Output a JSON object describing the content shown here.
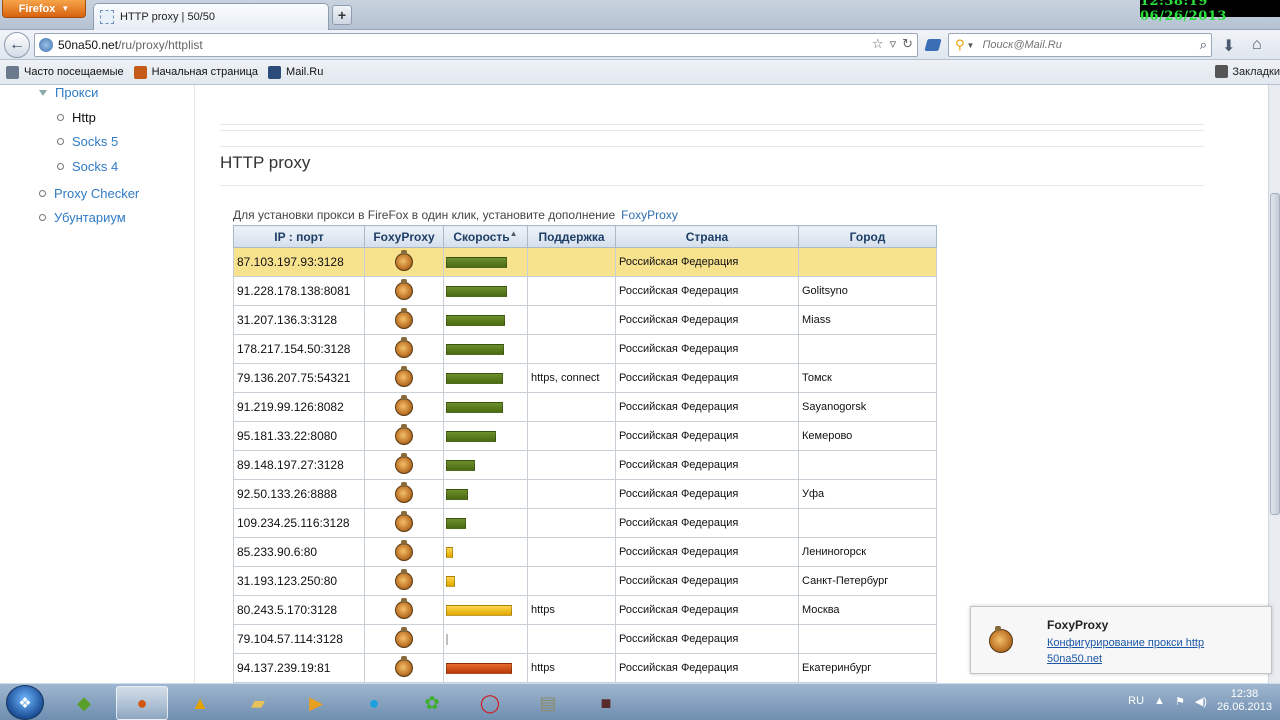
{
  "browser": {
    "app_button": "Firefox",
    "tab_title": "HTTP proxy | 50/50",
    "new_tab": "+",
    "clock": "12:38:19  06/26/2013",
    "url_host": "50na50.net",
    "url_path": "/ru/proxy/httplist",
    "search_placeholder": "Поиск@Mail.Ru"
  },
  "bookmarks": [
    {
      "label": "Часто посещаемые",
      "color": "#6a7a8c"
    },
    {
      "label": "Начальная страница",
      "color": "#c45b18"
    },
    {
      "label": "Mail.Ru",
      "color": "#2b4c7a"
    }
  ],
  "bookmarks_right": "Закладки",
  "sidebar": {
    "section": "Прокси",
    "items": [
      "Http",
      "Socks 5",
      "Socks 4"
    ],
    "links": [
      "Proxy Checker",
      "Убунтариум"
    ]
  },
  "page": {
    "title": "HTTP proxy",
    "info_text": "Для установки прокси в FireFox в один клик, установите дополнение",
    "info_link": "FoxyProxy"
  },
  "table": {
    "headers": [
      "IP : порт",
      "FoxyProxy",
      "Скорость",
      "Поддержка",
      "Страна",
      "Город"
    ],
    "rows": [
      {
        "ip": "87.103.197.93:3128",
        "speed": 0.92,
        "bar": "green",
        "support": "",
        "country": "Российская Федерация",
        "city": "",
        "highlight": true
      },
      {
        "ip": "91.228.178.138:8081",
        "speed": 0.92,
        "bar": "green",
        "support": "",
        "country": "Российская Федерация",
        "city": "Golitsyno"
      },
      {
        "ip": "31.207.136.3:3128",
        "speed": 0.89,
        "bar": "green",
        "support": "",
        "country": "Российская Федерация",
        "city": "Miass"
      },
      {
        "ip": "178.217.154.50:3128",
        "speed": 0.88,
        "bar": "green",
        "support": "",
        "country": "Российская Федерация",
        "city": ""
      },
      {
        "ip": "79.136.207.75:54321",
        "speed": 0.86,
        "bar": "green",
        "support": "https, connect",
        "country": "Российская Федерация",
        "city": "Томск"
      },
      {
        "ip": "91.219.99.126:8082",
        "speed": 0.86,
        "bar": "green",
        "support": "",
        "country": "Российская Федерация",
        "city": "Sayanogorsk"
      },
      {
        "ip": "95.181.33.22:8080",
        "speed": 0.75,
        "bar": "green",
        "support": "",
        "country": "Российская Федерация",
        "city": "Кемерово"
      },
      {
        "ip": "89.148.197.27:3128",
        "speed": 0.44,
        "bar": "green",
        "support": "",
        "country": "Российская Федерация",
        "city": ""
      },
      {
        "ip": "92.50.133.26:8888",
        "speed": 0.33,
        "bar": "green",
        "support": "",
        "country": "Российская Федерация",
        "city": "Уфа"
      },
      {
        "ip": "109.234.25.116:3128",
        "speed": 0.3,
        "bar": "green",
        "support": "",
        "country": "Российская Федерация",
        "city": ""
      },
      {
        "ip": "85.233.90.6:80",
        "speed": 0.11,
        "bar": "yellow",
        "support": "",
        "country": "Российская Федерация",
        "city": "Лениногорск"
      },
      {
        "ip": "31.193.123.250:80",
        "speed": 0.14,
        "bar": "yellow",
        "support": "",
        "country": "Российская Федерация",
        "city": "Санкт-Петербург"
      },
      {
        "ip": "80.243.5.170:3128",
        "speed": 1.0,
        "bar": "yellow",
        "support": "https",
        "country": "Российская Федерация",
        "city": "Москва"
      },
      {
        "ip": "79.104.57.114:3128",
        "speed": 0.02,
        "bar": "red",
        "support": "",
        "country": "Российская Федерация",
        "city": ""
      },
      {
        "ip": "94.137.239.19:81",
        "speed": 1.0,
        "bar": "red",
        "support": "https",
        "country": "Российская Федерация",
        "city": "Екатеринбург"
      }
    ]
  },
  "notification": {
    "title": "FoxyProxy",
    "link": "Конфигурирование прокси http 50na50.net"
  },
  "taskbar": {
    "clock_time": "12:38",
    "clock_date": "26.06.2013",
    "lang": "RU"
  }
}
